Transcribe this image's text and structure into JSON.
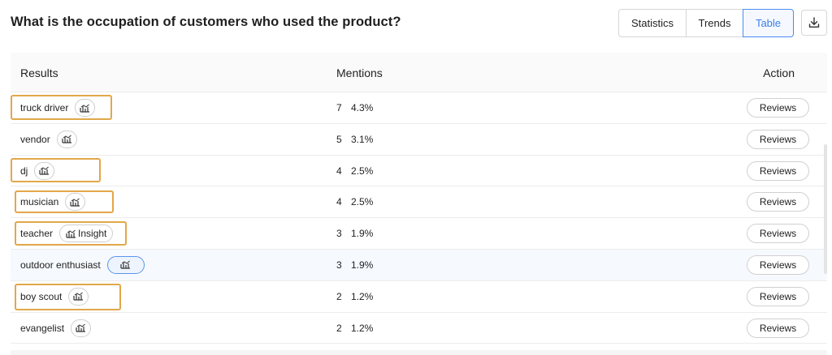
{
  "header": {
    "title": "What is the occupation of customers who used the product?",
    "tabs": [
      {
        "label": "Statistics",
        "active": false
      },
      {
        "label": "Trends",
        "active": false
      },
      {
        "label": "Table",
        "active": true
      }
    ],
    "download_icon": "download-icon"
  },
  "table": {
    "columns": {
      "results": "Results",
      "mentions": "Mentions",
      "action": "Action"
    },
    "rows": [
      {
        "label": "truck driver",
        "chip_text": "",
        "count": "7",
        "percent": "4.3%",
        "action": "Reviews"
      },
      {
        "label": "vendor",
        "chip_text": "",
        "count": "5",
        "percent": "3.1%",
        "action": "Reviews"
      },
      {
        "label": "dj",
        "chip_text": "",
        "count": "4",
        "percent": "2.5%",
        "action": "Reviews"
      },
      {
        "label": "musician",
        "chip_text": "",
        "count": "4",
        "percent": "2.5%",
        "action": "Reviews"
      },
      {
        "label": "teacher",
        "chip_text": "Insight",
        "count": "3",
        "percent": "1.9%",
        "action": "Reviews"
      },
      {
        "label": "outdoor enthusiast",
        "chip_text": "",
        "count": "3",
        "percent": "1.9%",
        "action": "Reviews"
      },
      {
        "label": "boy scout",
        "chip_text": "",
        "count": "2",
        "percent": "1.2%",
        "action": "Reviews"
      },
      {
        "label": "evangelist",
        "chip_text": "",
        "count": "2",
        "percent": "1.2%",
        "action": "Reviews"
      }
    ]
  },
  "colors": {
    "accent": "#3b7ded",
    "highlight": "#e2a74a"
  }
}
